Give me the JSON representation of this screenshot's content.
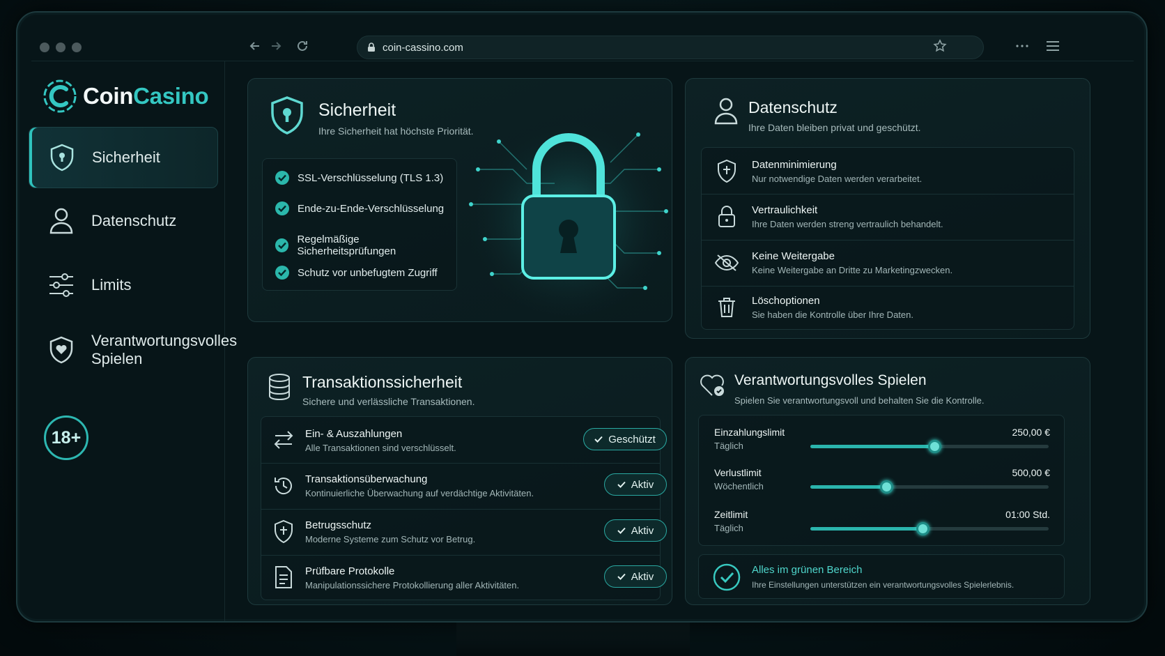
{
  "browser": {
    "url": "coin-cassino.com"
  },
  "brand": {
    "name_part1": "Coin",
    "name_part2": "Casino",
    "accent_color": "#34c7c2"
  },
  "sidebar": {
    "items": [
      {
        "label": "Sicherheit",
        "icon": "shield-icon",
        "active": true
      },
      {
        "label": "Datenschutz",
        "icon": "user-icon",
        "active": false
      },
      {
        "label": "Limits",
        "icon": "sliders-icon",
        "active": false
      },
      {
        "label": "Verantwortungsvolles Spielen",
        "icon": "shield-heart-icon",
        "active": false
      }
    ],
    "age_badge": "18+"
  },
  "security": {
    "title": "Sicherheit",
    "subtitle": "Ihre Sicherheit hat höchste Priorität.",
    "features": [
      "SSL-Verschlüsselung (TLS 1.3)",
      "Ende-zu-Ende-Verschlüsselung",
      "Regelmäßige Sicherheitsprüfungen",
      "Schutz vor unbefugtem Zugriff"
    ]
  },
  "privacy": {
    "title": "Datenschutz",
    "subtitle": "Ihre Daten bleiben privat und geschützt.",
    "items": [
      {
        "title": "Datenminimierung",
        "desc": "Nur notwendige Daten werden verarbeitet.",
        "icon": "shield-icon"
      },
      {
        "title": "Vertraulichkeit",
        "desc": "Ihre Daten werden streng vertraulich behandelt.",
        "icon": "lock-icon"
      },
      {
        "title": "Keine Weitergabe",
        "desc": "Keine Weitergabe an Dritte zu Marketingzwecken.",
        "icon": "eye-off-icon"
      },
      {
        "title": "Löschoptionen",
        "desc": "Sie haben die Kontrolle über Ihre Daten.",
        "icon": "trash-icon"
      }
    ]
  },
  "transactions": {
    "title": "Transaktionssicherheit",
    "subtitle": "Sichere und verlässliche Transaktionen.",
    "items": [
      {
        "title": "Ein- & Auszahlungen",
        "desc": "Alle Transaktionen sind verschlüsselt.",
        "badge": "Geschützt",
        "icon": "transfer-icon"
      },
      {
        "title": "Transaktionsüberwachung",
        "desc": "Kontinuierliche Überwachung auf verdächtige Aktivitäten.",
        "badge": "Aktiv",
        "icon": "history-icon"
      },
      {
        "title": "Betrugsschutz",
        "desc": "Moderne Systeme zum Schutz vor Betrug.",
        "badge": "Aktiv",
        "icon": "shield-icon"
      },
      {
        "title": "Prüfbare Protokolle",
        "desc": "Manipulationssichere Protokollierung aller Aktivitäten.",
        "badge": "Aktiv",
        "icon": "document-icon"
      }
    ]
  },
  "responsible": {
    "title": "Verantwortungsvolles Spielen",
    "subtitle": "Spielen Sie verantwortungsvoll und behalten Sie die Kontrolle.",
    "limits": [
      {
        "label": "Einzahlungslimit",
        "period": "Täglich",
        "value": "250,00 €",
        "level": 0.52
      },
      {
        "label": "Verlustlimit",
        "period": "Wöchentlich",
        "value": "500,00 €",
        "level": 0.32
      },
      {
        "label": "Zeitlimit",
        "period": "Täglich",
        "value": "01:00 Std.",
        "level": 0.47
      }
    ],
    "status_title": "Alles im grünen Bereich",
    "status_desc": "Ihre Einstellungen unterstützen ein verantwortungsvolles Spielerlebnis."
  }
}
